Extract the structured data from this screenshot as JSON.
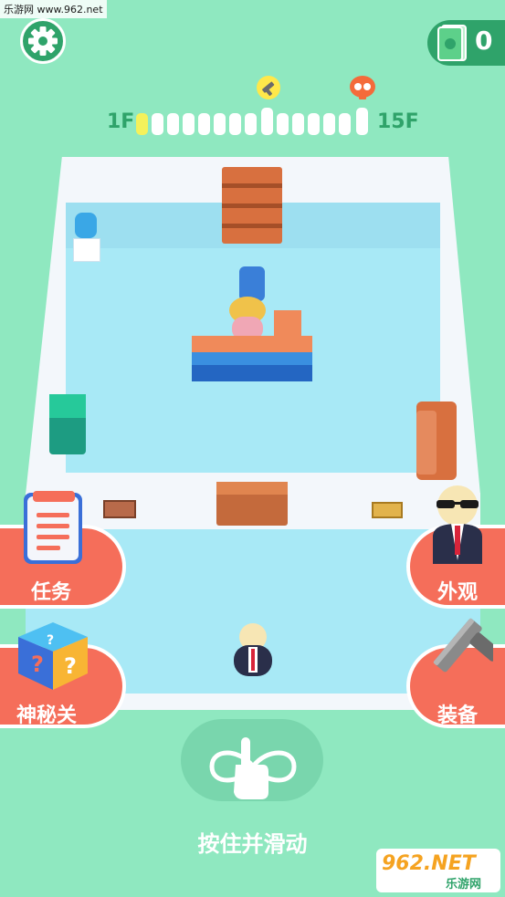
{
  "watermark_top": "乐游网 www.962.net",
  "money": {
    "value": "0"
  },
  "progress": {
    "start_label": "1F",
    "end_label": "15F",
    "current": 1,
    "total": 15
  },
  "buttons": {
    "tasks": "任务",
    "mystery": "神秘关",
    "appearance": "外观",
    "equipment": "装备"
  },
  "hint": "按住并滑动",
  "watermark_bottom": {
    "logo": "962.NET",
    "sub": "乐游网"
  },
  "colors": {
    "accent": "#2fa36a",
    "button": "#f56e5a",
    "background": "#8fe8c0"
  }
}
